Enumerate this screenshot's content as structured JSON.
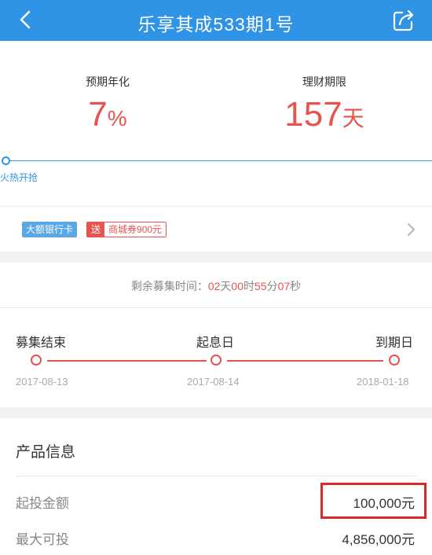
{
  "header": {
    "title": "乐享其成533期1号",
    "back_icon": "chevron-left-icon",
    "share_icon": "share-icon"
  },
  "rates": {
    "left": {
      "label": "预期年化",
      "value": "7",
      "unit": "%"
    },
    "right": {
      "label": "理财期限",
      "value": "157",
      "unit": "天"
    }
  },
  "progress": {
    "label": "火热开抢"
  },
  "tags": {
    "bank_card": "大额银行卡",
    "gift_prefix": "送",
    "gift_text": "商城券900元"
  },
  "countdown": {
    "prefix": "剩余募集时间：",
    "days": "02",
    "days_unit": "天",
    "hours": "00",
    "hours_unit": "时",
    "minutes": "55",
    "minutes_unit": "分",
    "seconds": "07",
    "seconds_unit": "秒"
  },
  "timeline": [
    {
      "label": "募集结束",
      "date": "2017-08-13"
    },
    {
      "label": "起息日",
      "date": "2017-08-14"
    },
    {
      "label": "到期日",
      "date": "2018-01-18"
    }
  ],
  "product_info": {
    "title": "产品信息",
    "rows": [
      {
        "label": "起投金额",
        "value": "100,000元"
      },
      {
        "label": "最大可投",
        "value": "4,856,000元"
      }
    ]
  },
  "colors": {
    "brand_blue": "#2f93e6",
    "accent_red": "#e8534f"
  }
}
